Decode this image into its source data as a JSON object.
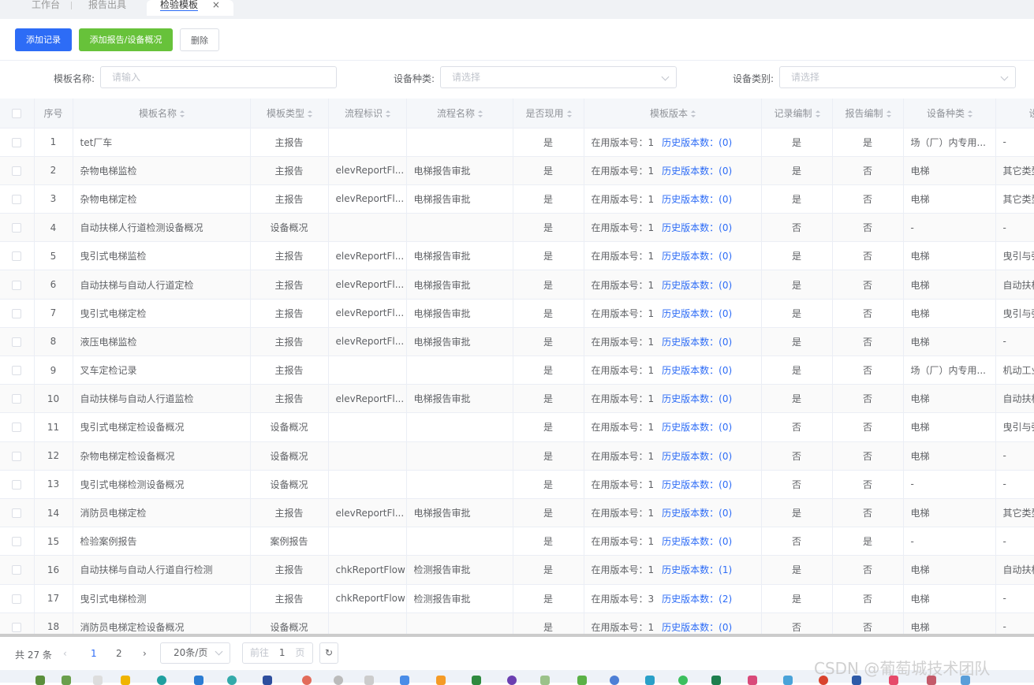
{
  "tabs": {
    "items": [
      "工作台",
      "报告出具",
      "检验模板"
    ],
    "close": "×"
  },
  "toolbar": {
    "add_record": "添加记录",
    "add_report": "添加报告/设备概况",
    "delete": "删除"
  },
  "search": {
    "template_name_label": "模板名称:",
    "template_name_placeholder": "请输入",
    "device_kind_label": "设备种类:",
    "device_kind_placeholder": "请选择",
    "device_category_label": "设备类别:",
    "device_category_placeholder": "请选择"
  },
  "table": {
    "columns": [
      "序号",
      "模板名称",
      "模板类型",
      "流程标识",
      "流程名称",
      "是否现用",
      "模板版本",
      "记录编制",
      "报告编制",
      "设备种类",
      "设备"
    ],
    "version_prefix": "在用版本号：",
    "history_prefix": "历史版本数：",
    "rows": [
      [
        "1",
        "tet厂车",
        "主报告",
        "",
        "",
        "是",
        "1",
        "(0)",
        "是",
        "是",
        "场（厂）内专用...",
        "-"
      ],
      [
        "2",
        "杂物电梯监检",
        "主报告",
        "elevReportFl...",
        "电梯报告审批",
        "是",
        "1",
        "(0)",
        "是",
        "否",
        "电梯",
        "其它类型"
      ],
      [
        "3",
        "杂物电梯定检",
        "主报告",
        "elevReportFl...",
        "电梯报告审批",
        "是",
        "1",
        "(0)",
        "是",
        "否",
        "电梯",
        "其它类型"
      ],
      [
        "4",
        "自动扶梯人行道检测设备概况",
        "设备概况",
        "",
        "",
        "是",
        "1",
        "(0)",
        "否",
        "否",
        "-",
        "-"
      ],
      [
        "5",
        "曳引式电梯监检",
        "主报告",
        "elevReportFl...",
        "电梯报告审批",
        "是",
        "1",
        "(0)",
        "是",
        "否",
        "电梯",
        "曳引与强"
      ],
      [
        "6",
        "自动扶梯与自动人行道定检",
        "主报告",
        "elevReportFl...",
        "电梯报告审批",
        "是",
        "1",
        "(0)",
        "是",
        "否",
        "电梯",
        "自动扶梯"
      ],
      [
        "7",
        "曳引式电梯定检",
        "主报告",
        "elevReportFl...",
        "电梯报告审批",
        "是",
        "1",
        "(0)",
        "是",
        "否",
        "电梯",
        "曳引与强"
      ],
      [
        "8",
        "液压电梯监检",
        "主报告",
        "elevReportFl...",
        "电梯报告审批",
        "是",
        "1",
        "(0)",
        "是",
        "否",
        "电梯",
        "-"
      ],
      [
        "9",
        "叉车定检记录",
        "主报告",
        "",
        "",
        "是",
        "1",
        "(0)",
        "是",
        "否",
        "场（厂）内专用...",
        "机动工业"
      ],
      [
        "10",
        "自动扶梯与自动人行道监检",
        "主报告",
        "elevReportFl...",
        "电梯报告审批",
        "是",
        "1",
        "(0)",
        "是",
        "否",
        "电梯",
        "自动扶梯"
      ],
      [
        "11",
        "曳引式电梯定检设备概况",
        "设备概况",
        "",
        "",
        "是",
        "1",
        "(0)",
        "否",
        "否",
        "电梯",
        "曳引与强"
      ],
      [
        "12",
        "杂物电梯定检设备概况",
        "设备概况",
        "",
        "",
        "是",
        "1",
        "(0)",
        "否",
        "否",
        "电梯",
        "-"
      ],
      [
        "13",
        "曳引式电梯检测设备概况",
        "设备概况",
        "",
        "",
        "是",
        "1",
        "(0)",
        "否",
        "否",
        "-",
        "-"
      ],
      [
        "14",
        "消防员电梯定检",
        "主报告",
        "elevReportFl...",
        "电梯报告审批",
        "是",
        "1",
        "(0)",
        "是",
        "否",
        "电梯",
        "其它类型"
      ],
      [
        "15",
        "检验案例报告",
        "案例报告",
        "",
        "",
        "是",
        "1",
        "(0)",
        "否",
        "是",
        "-",
        "-"
      ],
      [
        "16",
        "自动扶梯与自动人行道自行检测",
        "主报告",
        "chkReportFlow",
        "检测报告审批",
        "是",
        "1",
        "(1)",
        "是",
        "否",
        "电梯",
        "自动扶梯"
      ],
      [
        "17",
        "曳引式电梯检测",
        "主报告",
        "chkReportFlow",
        "检测报告审批",
        "是",
        "3",
        "(2)",
        "是",
        "否",
        "电梯",
        "-"
      ],
      [
        "18",
        "消防员电梯定检设备概况",
        "设备概况",
        "",
        "",
        "是",
        "1",
        "(0)",
        "否",
        "否",
        "电梯",
        "-"
      ]
    ]
  },
  "pager": {
    "total": "共 27 条",
    "page1": "1",
    "page2": "2",
    "page_size": "20条/页",
    "goto_prefix": "前往",
    "goto_value": "1",
    "goto_suffix": "页"
  },
  "watermark": "CSDN @葡萄城技术团队"
}
